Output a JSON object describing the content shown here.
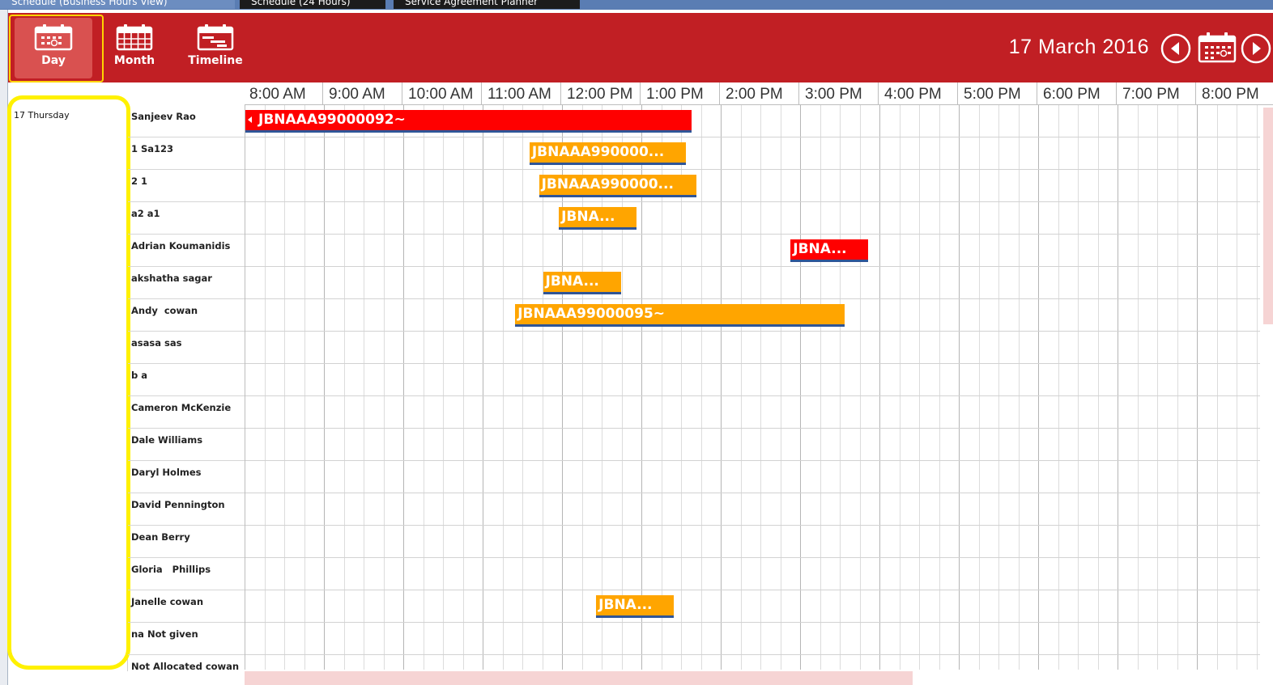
{
  "tabs": [
    {
      "label": "Schedule (Business Hours View)",
      "active": true
    },
    {
      "label": "Schedule (24 Hours)",
      "active": false
    },
    {
      "label": "Service Agreement Planner",
      "active": false
    }
  ],
  "toolbar": {
    "day_label": "Day",
    "month_label": "Month",
    "timeline_label": "Timeline",
    "current_date": "17 March 2016",
    "prev_icon": "arrow-left-circle-icon",
    "next_icon": "arrow-right-circle-icon",
    "calendar_icon": "calendar-icon"
  },
  "colors": {
    "toolbar": "#c11f24",
    "appointment_red": "#ff0000",
    "appointment_orange": "#ffa500",
    "appointment_underline": "#2f5597",
    "highlight": "#fff100"
  },
  "day": {
    "label": "17 Thursday"
  },
  "hours": [
    "8:00 AM",
    "9:00 AM",
    "10:00 AM",
    "11:00 AM",
    "12:00 PM",
    "1:00 PM",
    "2:00 PM",
    "3:00 PM",
    "4:00 PM",
    "5:00 PM",
    "6:00 PM",
    "7:00 PM",
    "8:00 PM"
  ],
  "resources": [
    {
      "name": "Sanjeev Rao"
    },
    {
      "name": "1 Sa123"
    },
    {
      "name": "2 1"
    },
    {
      "name": "a2 a1"
    },
    {
      "name": "Adrian Koumanidis"
    },
    {
      "name": "akshatha sagar"
    },
    {
      "name": "Andy  cowan"
    },
    {
      "name": "asasa sas"
    },
    {
      "name": "b a"
    },
    {
      "name": "Cameron McKenzie"
    },
    {
      "name": "Dale Williams"
    },
    {
      "name": "Daryl Holmes"
    },
    {
      "name": "David Pennington"
    },
    {
      "name": "Dean Berry"
    },
    {
      "name": "Gloria   Phillips"
    },
    {
      "name": "Janelle cowan"
    },
    {
      "name": "na Not given"
    },
    {
      "name": "Not Allocated cowan"
    }
  ],
  "appointments": [
    {
      "row": 0,
      "start": 8.0,
      "end": 13.62,
      "label": "JBNAAA99000092~",
      "color": "red",
      "continued": true
    },
    {
      "row": 1,
      "start": 11.58,
      "end": 13.55,
      "label": "JBNAAA990000...",
      "color": "orange",
      "continued": false
    },
    {
      "row": 2,
      "start": 11.7,
      "end": 13.68,
      "label": "JBNAAA990000...",
      "color": "orange",
      "continued": false
    },
    {
      "row": 3,
      "start": 11.95,
      "end": 12.93,
      "label": "JBNA...",
      "color": "orange",
      "continued": false
    },
    {
      "row": 4,
      "start": 14.87,
      "end": 15.85,
      "label": "JBNA...",
      "color": "red",
      "continued": false
    },
    {
      "row": 5,
      "start": 11.75,
      "end": 12.73,
      "label": "JBNA...",
      "color": "orange",
      "continued": false
    },
    {
      "row": 6,
      "start": 11.4,
      "end": 15.55,
      "label": "JBNAAA99000095~",
      "color": "orange",
      "continued": false
    },
    {
      "row": 15,
      "start": 12.42,
      "end": 13.4,
      "label": "JBNA...",
      "color": "orange",
      "continued": false
    }
  ]
}
